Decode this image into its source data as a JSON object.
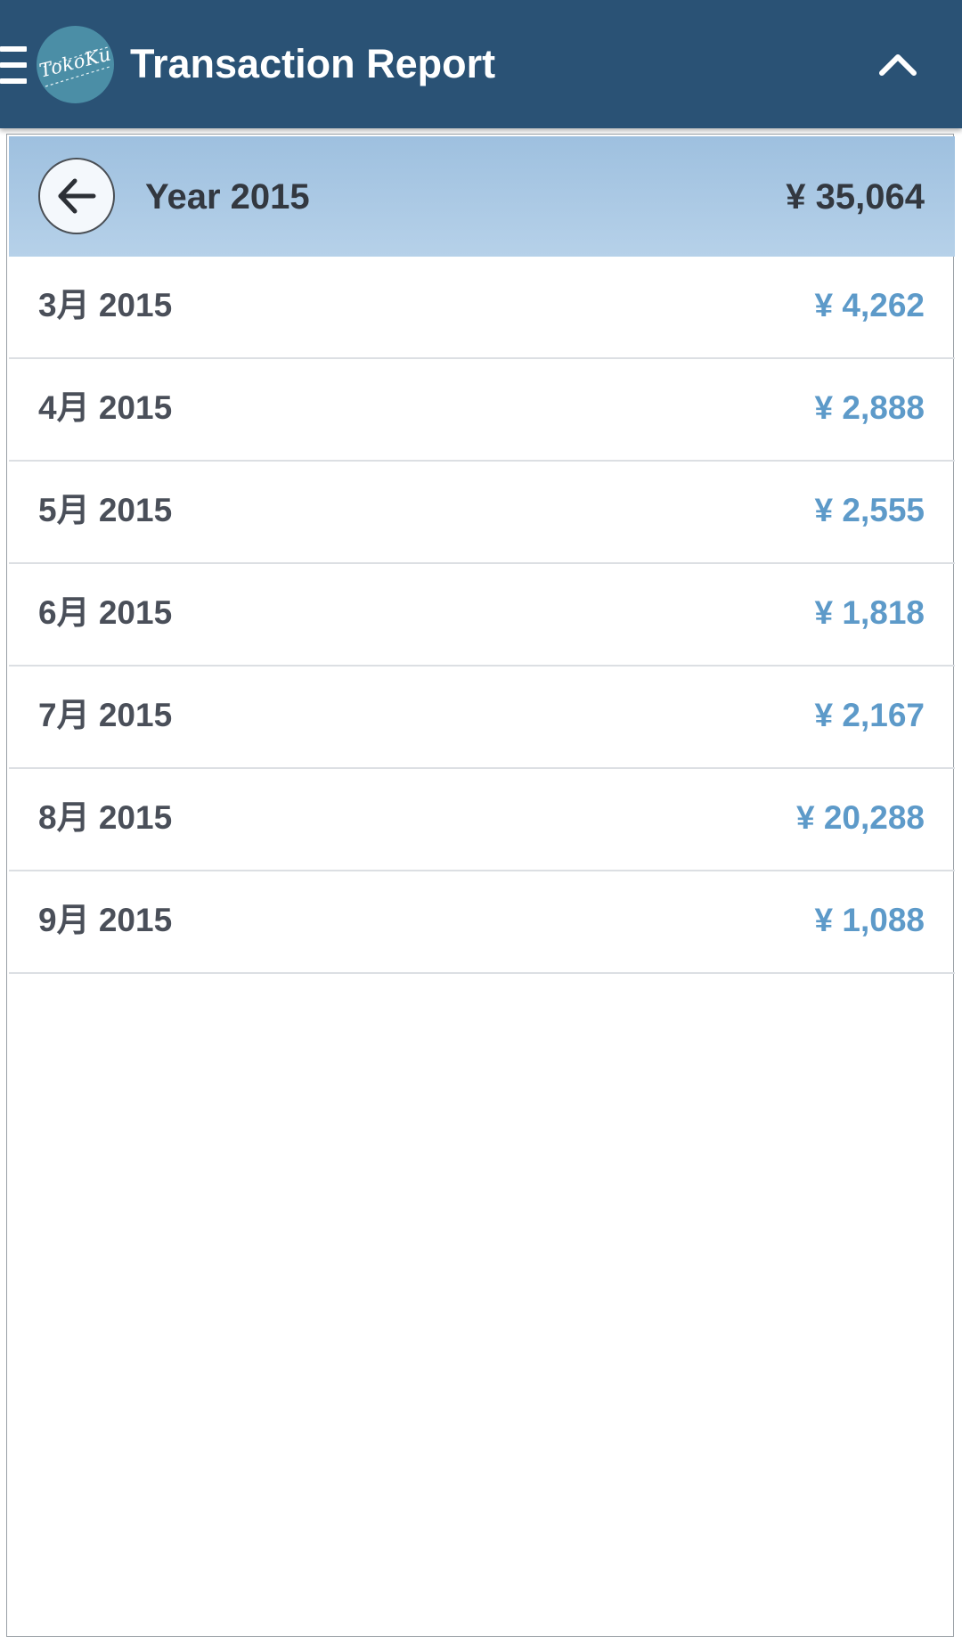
{
  "app_bar": {
    "menu_icon": "hamburger-menu-icon",
    "logo_text": "TokoKu",
    "title": "Transaction Report",
    "collapse_icon": "chevron-up-icon",
    "background_color": "#2a5275"
  },
  "year_header": {
    "back_icon": "arrow-left-icon",
    "label": "Year 2015",
    "total": "¥ 35,064",
    "background_color": "#b6d1e9"
  },
  "months": [
    {
      "label": "3月 2015",
      "amount": "¥ 4,262"
    },
    {
      "label": "4月 2015",
      "amount": "¥ 2,888"
    },
    {
      "label": "5月 2015",
      "amount": "¥ 2,555"
    },
    {
      "label": "6月 2015",
      "amount": "¥ 1,818"
    },
    {
      "label": "7月 2015",
      "amount": "¥ 2,167"
    },
    {
      "label": "8月 2015",
      "amount": "¥ 20,288"
    },
    {
      "label": "9月 2015",
      "amount": "¥ 1,088"
    }
  ],
  "colors": {
    "amount_text": "#5d9ac9",
    "label_text": "#4a4f59"
  }
}
